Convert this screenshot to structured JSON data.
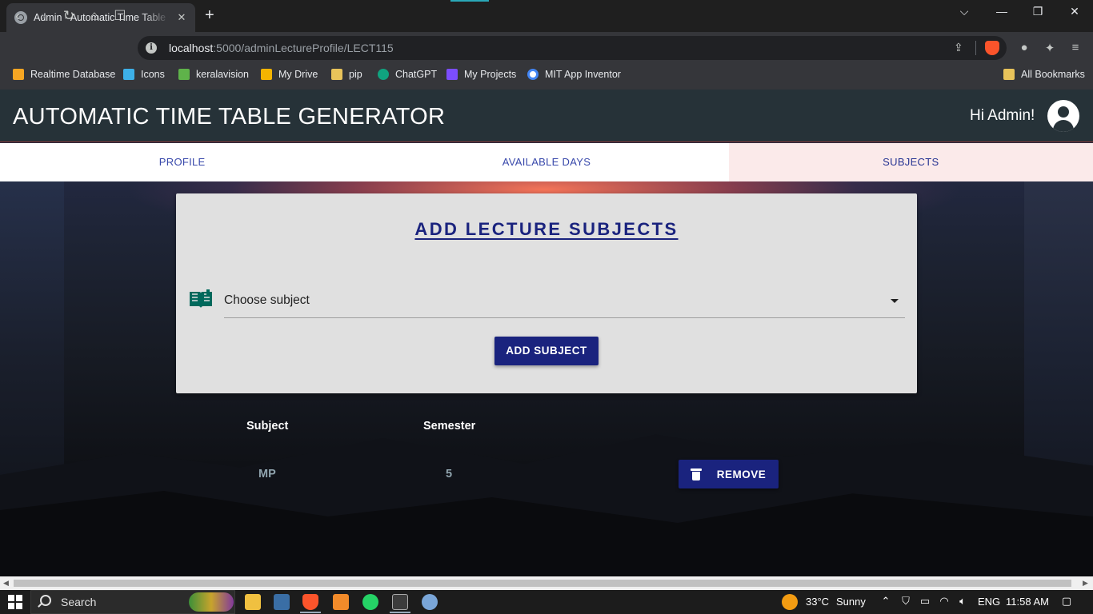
{
  "browser": {
    "tab_title": "Admin - Automatic Time Table Generator",
    "tab_close": "✕",
    "new_tab": "+",
    "window_controls": {
      "minimize": "⌵",
      "restore": "—",
      "maximize": "❐",
      "close": "✕"
    },
    "nav": {
      "back": "‹",
      "forward": "›",
      "reload": "↻",
      "home": "⌂",
      "bookmark": "☐"
    },
    "url_host": "localhost",
    "url_path": ":5000/adminLectureProfile/LECT115",
    "bookmarks": [
      {
        "label": "Realtime Database",
        "icon": "firebase-icon",
        "color": "#f6a623"
      },
      {
        "label": "Icons",
        "icon": "icons8-icon",
        "color": "#3db0e8"
      },
      {
        "label": "keralavision",
        "icon": "keralavision-icon",
        "color": "#5fb34a"
      },
      {
        "label": "My Drive",
        "icon": "google-drive-icon",
        "color": "#f4b400"
      },
      {
        "label": "pip",
        "icon": "folder-icon",
        "color": "#e8c35a"
      },
      {
        "label": "ChatGPT",
        "icon": "chatgpt-icon",
        "color": "#10a37f"
      },
      {
        "label": "My Projects",
        "icon": "bolt-icon",
        "color": "#7c4dff"
      },
      {
        "label": "MIT App Inventor",
        "icon": "google-icon",
        "color": "#4285f4"
      }
    ],
    "all_bookmarks": "All Bookmarks"
  },
  "app": {
    "title": "AUTOMATIC TIME TABLE GENERATOR",
    "greeting": "Hi Admin!",
    "tabs": [
      {
        "label": "PROFILE",
        "active": false
      },
      {
        "label": "AVAILABLE DAYS",
        "active": false
      },
      {
        "label": "SUBJECTS",
        "active": true
      }
    ],
    "card": {
      "heading": "ADD LECTURE SUBJECTS",
      "select_placeholder": "Choose subject",
      "add_button": "ADD SUBJECT"
    },
    "table": {
      "headers": [
        "Subject",
        "Semester"
      ],
      "rows": [
        {
          "subject": "MP",
          "semester": "5",
          "action": "REMOVE"
        }
      ]
    },
    "colors": {
      "appbar": "#263238",
      "primary": "#1a237e",
      "tab_text": "#3949ab",
      "active_tab_bg": "#fbeaea"
    }
  },
  "taskbar": {
    "search": "Search",
    "weather_temp": "33°C",
    "weather_text": "Sunny",
    "language": "ENG",
    "time": "11:58 AM"
  }
}
